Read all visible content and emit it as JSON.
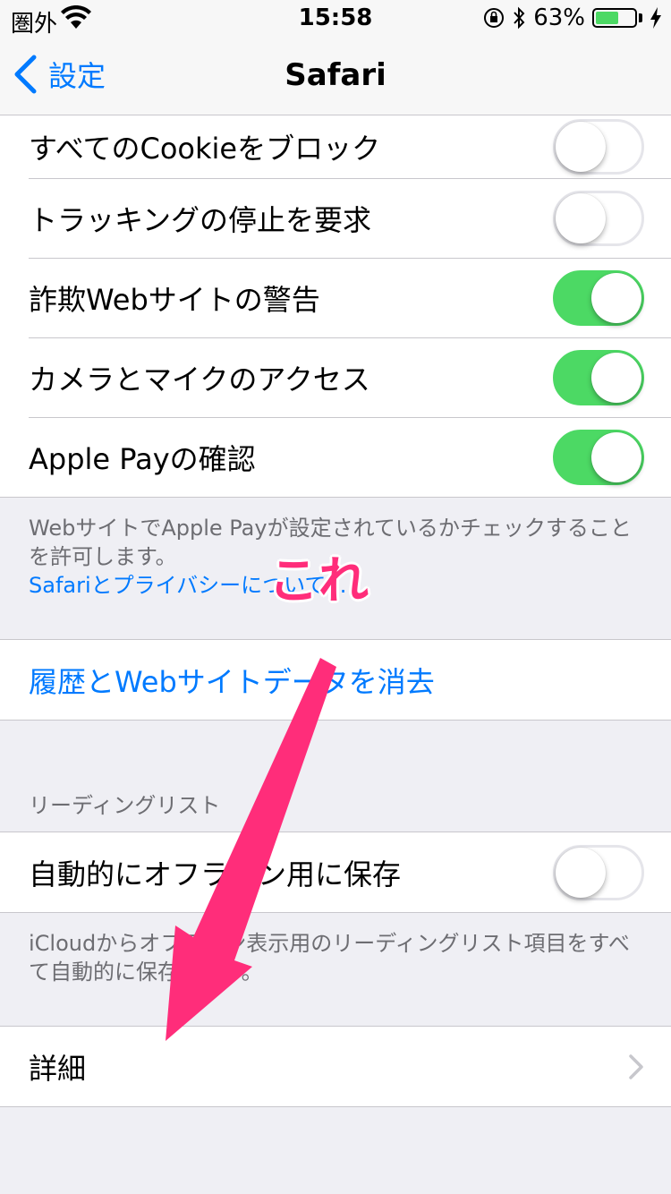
{
  "status_bar": {
    "carrier": "圏外",
    "time": "15:58",
    "battery_percent": "63%",
    "battery_level": 0.63,
    "icons": [
      "wifi-icon",
      "orientation-lock-icon",
      "bluetooth-icon",
      "battery-icon",
      "charging-bolt-icon"
    ]
  },
  "nav": {
    "back_label": "設定",
    "title": "Safari"
  },
  "privacy_group": {
    "items": [
      {
        "label": "すべてのCookieをブロック",
        "on": false
      },
      {
        "label": "トラッキングの停止を要求",
        "on": false
      },
      {
        "label": "詐欺Webサイトの警告",
        "on": true
      },
      {
        "label": "カメラとマイクのアクセス",
        "on": true
      },
      {
        "label": "Apple Payの確認",
        "on": true
      }
    ],
    "footer": "WebサイトでApple Payが設定されているかチェックすることを許可します。",
    "footer_link": "Safariとプライバシーについて..."
  },
  "clear_history": {
    "label": "履歴とWebサイトデータを消去"
  },
  "reading_list": {
    "header": "リーディングリスト",
    "item": {
      "label": "自動的にオフライン用に保存",
      "on": false
    },
    "footer": "iCloudからオフライン表示用のリーディングリスト項目をすべて自動的に保存します。"
  },
  "advanced": {
    "label": "詳細"
  },
  "annotation": {
    "label": "これ",
    "color": "#ff2d7a"
  },
  "colors": {
    "accent": "#007aff",
    "toggle_on": "#4cd964",
    "background": "#efeff4"
  }
}
